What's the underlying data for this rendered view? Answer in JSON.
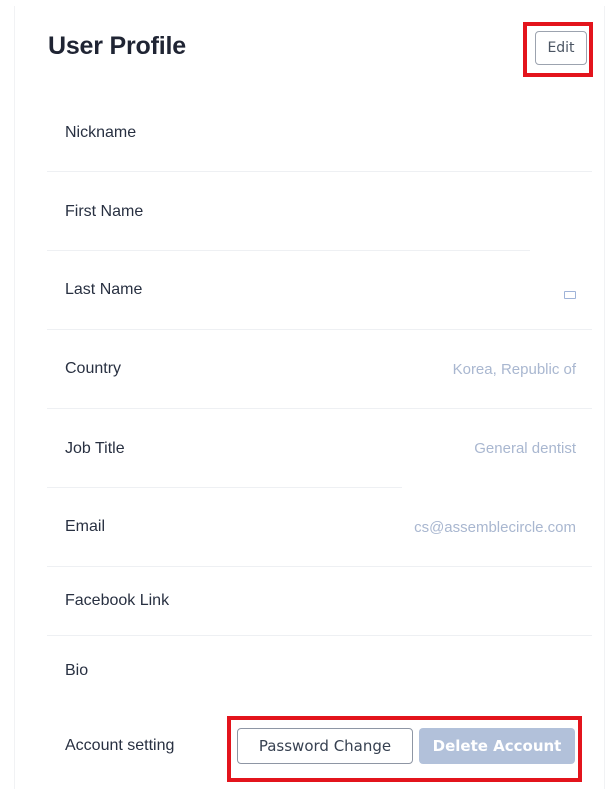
{
  "header": {
    "title": "User Profile",
    "edit_label": "Edit"
  },
  "fields": {
    "nickname": {
      "label": "Nickname",
      "value": ""
    },
    "first_name": {
      "label": "First Name",
      "value": ""
    },
    "last_name": {
      "label": "Last Name",
      "value": ""
    },
    "country": {
      "label": "Country",
      "value": "Korea, Republic of"
    },
    "job_title": {
      "label": "Job Title",
      "value": "General dentist"
    },
    "email": {
      "label": "Email",
      "value": "cs@assemblecircle.com"
    },
    "facebook_link": {
      "label": "Facebook Link",
      "value": ""
    },
    "bio": {
      "label": "Bio",
      "value": ""
    }
  },
  "account": {
    "label": "Account setting",
    "password_change_label": "Password Change",
    "delete_account_label": "Delete Account"
  },
  "colors": {
    "highlight": "#e3141c",
    "value_text": "#a9b7d0",
    "delete_button_bg": "#b2c1da"
  }
}
